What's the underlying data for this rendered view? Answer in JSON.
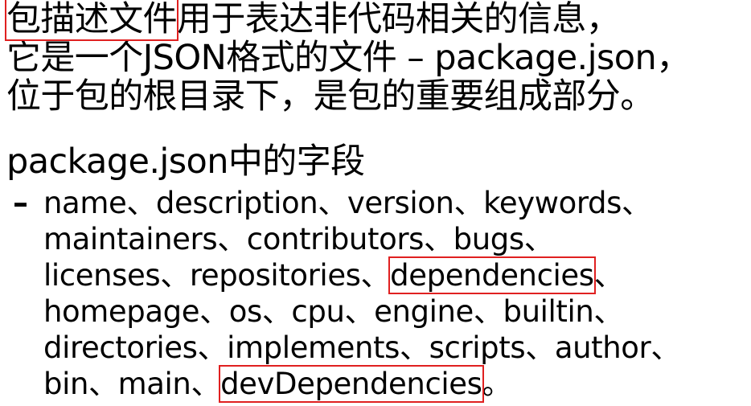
{
  "intro": {
    "highlighted_term": "包描述文件",
    "line1_rest": "用于表达非代码相关的信息，",
    "line2": "它是一个JSON格式的文件 – package.json，",
    "line3": "位于包的根目录下，是包的重要组成部分。"
  },
  "heading": "package.json中的字段",
  "bullet_marker": "–",
  "fields": {
    "line1": "name、description、version、keywords、",
    "line2": "maintainers、contributors、bugs、",
    "line3_pre": "licenses、repositories、",
    "line3_highlight": "dependencies",
    "line3_post": "、",
    "line4": "homepage、os、cpu、engine、builtin、",
    "line5": "directories、implements、scripts、author、",
    "line6_pre": "bin、main、",
    "line6_highlight": "devDependencies",
    "line6_post": "。"
  },
  "colors": {
    "highlight_border": "#e02020",
    "text": "#000000",
    "background": "#ffffff"
  }
}
